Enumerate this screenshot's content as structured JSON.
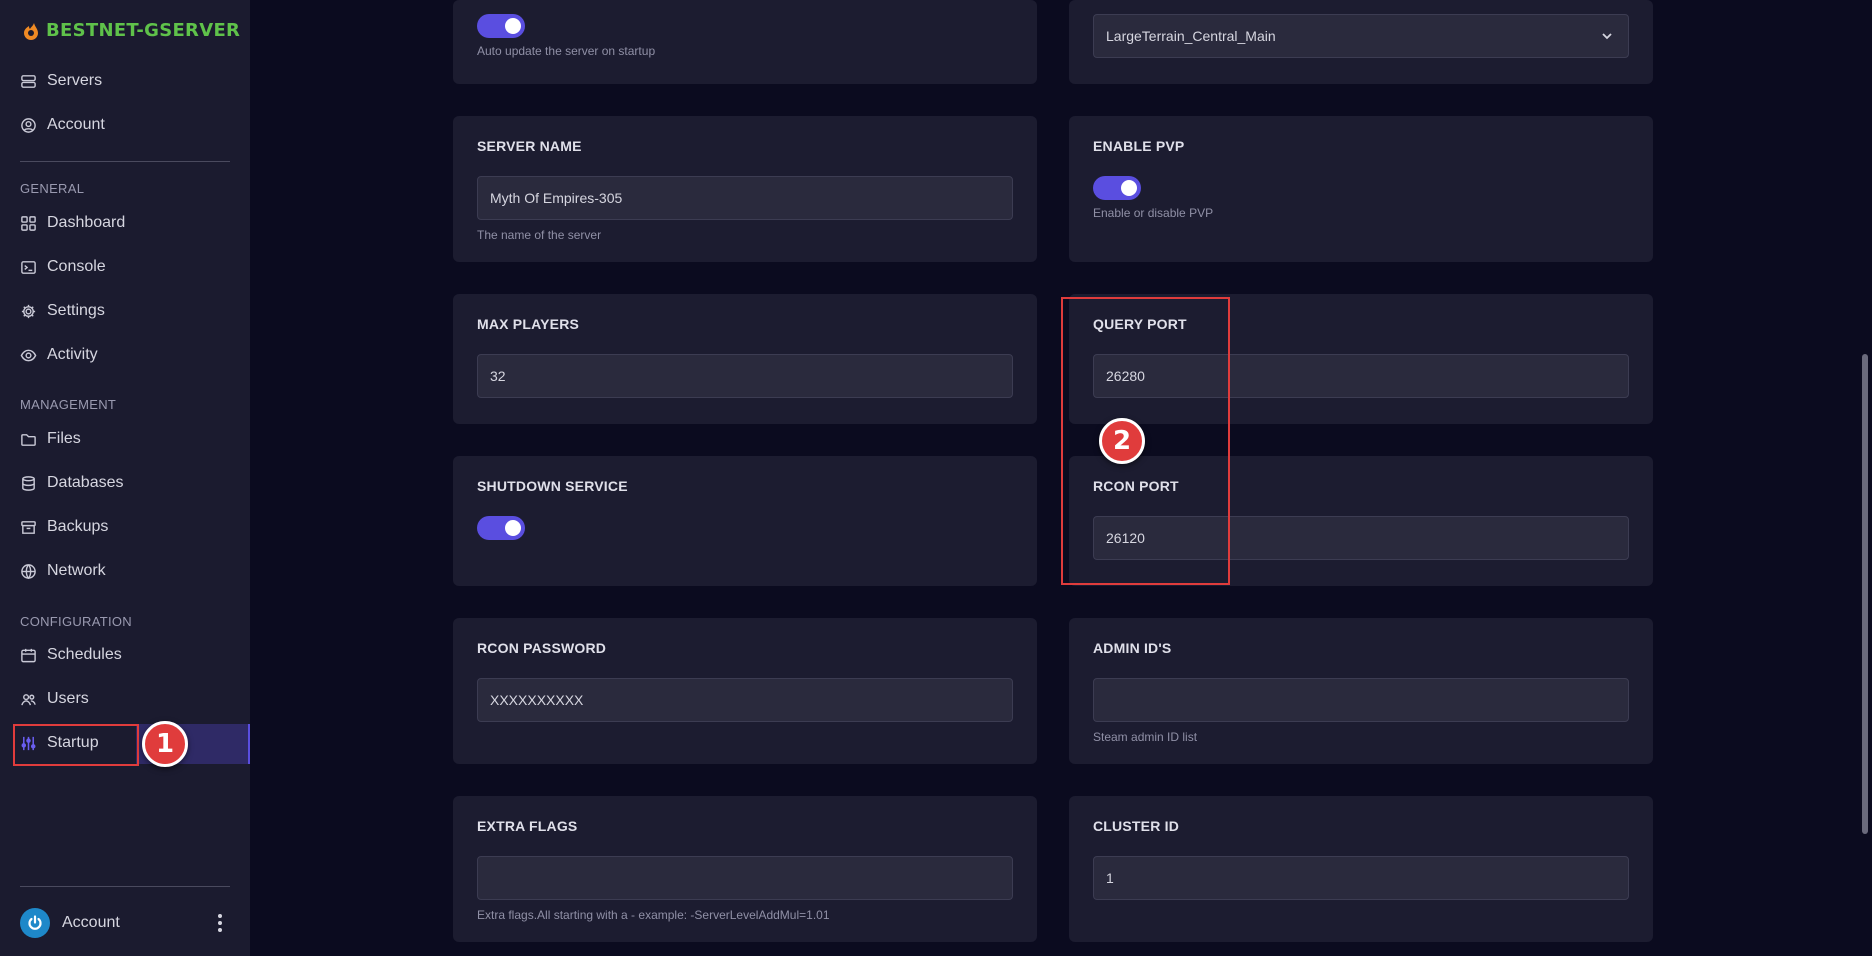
{
  "brand": {
    "name": "BESTNET-GSERVER"
  },
  "sidebar": {
    "top_items": [
      {
        "label": "Servers",
        "icon": "server-icon"
      },
      {
        "label": "Account",
        "icon": "user-circle-icon"
      }
    ],
    "sections": {
      "general": "GENERAL",
      "management": "MANAGEMENT",
      "configuration": "CONFIGURATION"
    },
    "general_items": [
      {
        "label": "Dashboard",
        "icon": "grid-icon"
      },
      {
        "label": "Console",
        "icon": "terminal-icon"
      },
      {
        "label": "Settings",
        "icon": "gear-icon"
      },
      {
        "label": "Activity",
        "icon": "eye-icon"
      }
    ],
    "management_items": [
      {
        "label": "Files",
        "icon": "folder-icon"
      },
      {
        "label": "Databases",
        "icon": "database-icon"
      },
      {
        "label": "Backups",
        "icon": "archive-icon"
      },
      {
        "label": "Network",
        "icon": "globe-icon"
      }
    ],
    "configuration_items": [
      {
        "label": "Schedules",
        "icon": "calendar-icon"
      },
      {
        "label": "Users",
        "icon": "users-icon"
      },
      {
        "label": "Startup",
        "icon": "sliders-icon",
        "active": true
      }
    ],
    "bottom_account": {
      "label": "Account"
    }
  },
  "annotations": {
    "step1": "1",
    "step2": "2",
    "highlight_color": "#e03c3c"
  },
  "colors": {
    "accent": "#5a4ee0",
    "brand": "#5fc24a"
  },
  "cards": {
    "auto_update": {
      "help": "Auto update the server on startup",
      "enabled": true
    },
    "map": {
      "value": "LargeTerrain_Central_Main"
    },
    "server_name": {
      "title": "SERVER NAME",
      "value": "Myth Of Empires-305",
      "help": "The name of the server"
    },
    "enable_pvp": {
      "title": "ENABLE PVP",
      "help": "Enable or disable PVP",
      "enabled": true
    },
    "max_players": {
      "title": "MAX PLAYERS",
      "value": "32"
    },
    "query_port": {
      "title": "QUERY PORT",
      "value": "26280"
    },
    "shutdown_service": {
      "title": "SHUTDOWN SERVICE",
      "enabled": true
    },
    "rcon_port": {
      "title": "RCON PORT",
      "value": "26120"
    },
    "rcon_password": {
      "title": "RCON PASSWORD",
      "value": "XXXXXXXXXX"
    },
    "admin_ids": {
      "title": "ADMIN ID'S",
      "value": "",
      "help": "Steam admin ID list"
    },
    "extra_flags": {
      "title": "EXTRA FLAGS",
      "value": "",
      "help": "Extra flags.All starting with a - example: -ServerLevelAddMul=1.01"
    },
    "cluster_id": {
      "title": "CLUSTER ID",
      "value": "1"
    }
  }
}
